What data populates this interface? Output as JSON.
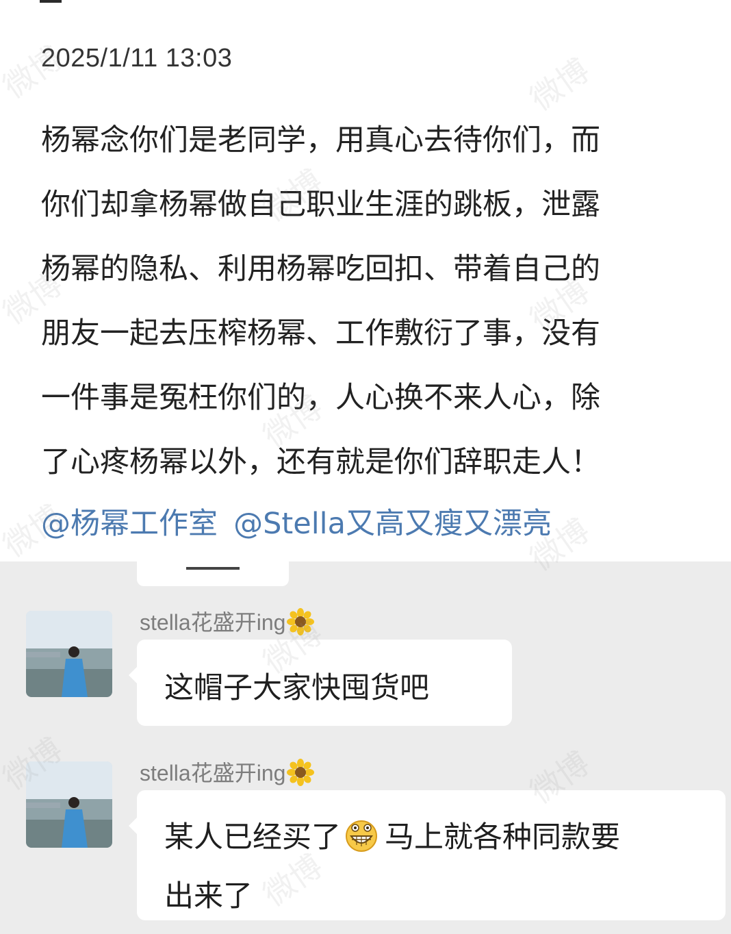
{
  "post": {
    "timestamp": "2025/1/11 13:03",
    "lines": [
      "杨幂念你们是老同学，用真心去待你们，而",
      "你们却拿杨幂做自己职业生涯的跳板，泄露",
      "杨幂的隐私、利用杨幂吃回扣、带着自己的",
      "朋友一起去压榨杨幂、工作敷衍了事，没有",
      "一件事是冤枉你们的，人心换不来人心，除",
      "了心疼杨幂以外，还有就是你们辞职走人！"
    ],
    "mentions": [
      "@杨幂工作室",
      "@Stella又高又瘦又漂亮"
    ]
  },
  "chat": {
    "messages": [
      {
        "sender": "stella花盛开ing",
        "sender_emoji": "sunflower-icon",
        "lines": [
          "这帽子大家快囤货吧"
        ]
      },
      {
        "sender": "stella花盛开ing",
        "sender_emoji": "sunflower-icon",
        "lines": [
          "某人已经买了",
          "马上就各种同款要",
          "出来了"
        ],
        "inline_emoji": "grin-emoji-icon"
      }
    ]
  },
  "watermark": "微博",
  "colors": {
    "mention": "#4c7ab0",
    "chat_background": "#ececec",
    "bubble": "#ffffff",
    "sender": "#7d7d7d"
  }
}
